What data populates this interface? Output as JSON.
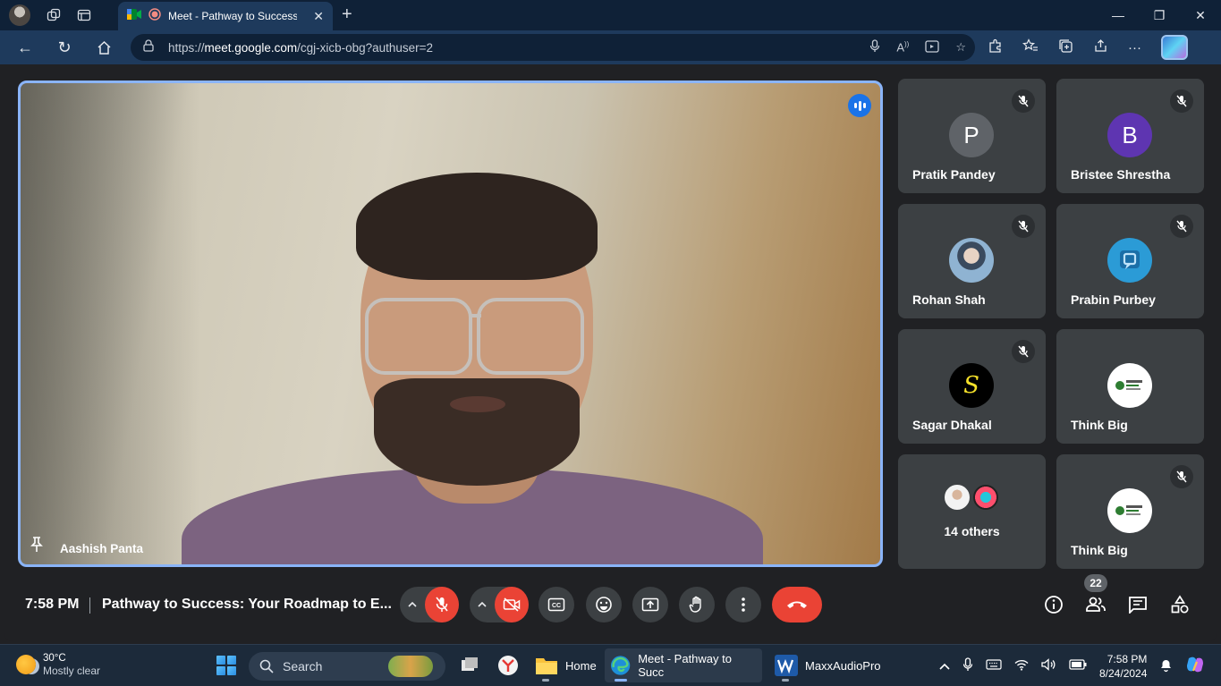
{
  "browser": {
    "tab_title": "Meet - Pathway to Success",
    "url_prefix": "https://",
    "url_host": "meet.google.com",
    "url_path": "/cgj-xicb-obg?authuser=2"
  },
  "main_speaker": {
    "name": "Aashish Panta"
  },
  "participants": [
    {
      "name": "Pratik Pandey",
      "initial": "P",
      "avatar_color": "#5f6368",
      "muted": true
    },
    {
      "name": "Bristee Shrestha",
      "initial": "B",
      "avatar_color": "#5e35b1",
      "muted": true
    },
    {
      "name": "Rohan Shah",
      "initial": "",
      "avatar_color": "#7fa7c9",
      "muted": true
    },
    {
      "name": "Prabin Purbey",
      "initial": "",
      "avatar_color": "#2b9bd6",
      "muted": true
    },
    {
      "name": "Sagar Dhakal",
      "initial": "S",
      "avatar_color": "#000000",
      "muted": true
    },
    {
      "name": "Think Big",
      "initial": "",
      "avatar_color": "#ffffff",
      "muted": false
    },
    {
      "name": "Think Big",
      "initial": "",
      "avatar_color": "#ffffff",
      "muted": true
    }
  ],
  "others": {
    "label": "14 others"
  },
  "meeting": {
    "time": "7:58 PM",
    "title": "Pathway to Success: Your Roadmap to E...",
    "people_count": "22"
  },
  "taskbar": {
    "temperature": "30°C",
    "weather": "Mostly clear",
    "search_placeholder": "Search",
    "apps": [
      {
        "label": "Home"
      },
      {
        "label": "Meet - Pathway to Succ"
      },
      {
        "label": "MaxxAudioPro"
      }
    ],
    "clock_time": "7:58 PM",
    "clock_date": "8/24/2024"
  },
  "colors": {
    "accent": "#8ab4f8",
    "danger": "#ea4335",
    "meet_bg": "#202124",
    "tile_bg": "#3c4043"
  }
}
